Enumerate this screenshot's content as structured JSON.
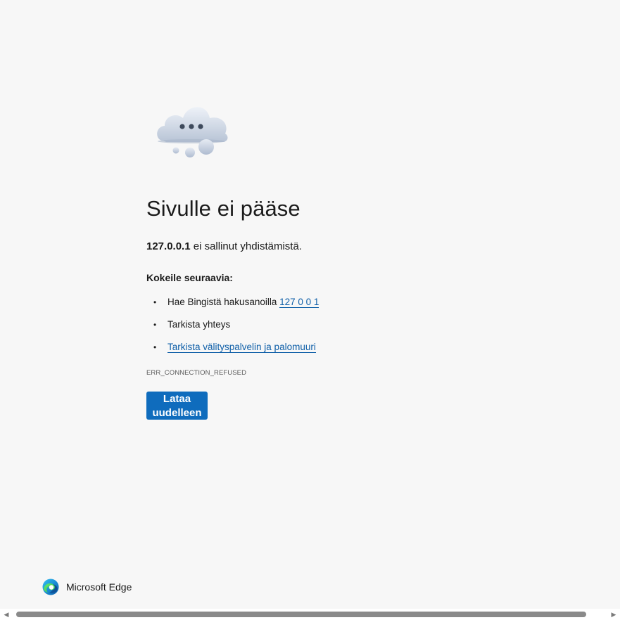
{
  "error_page": {
    "title": "Sivulle ei pääse",
    "message_host": "127.0.0.1",
    "message_text": " ei sallinut yhdistämistä.",
    "suggestions_heading": "Kokeile seuraavia:",
    "suggestions": [
      {
        "prefix": "Hae Bingistä hakusanoilla ",
        "link": "127 0 0 1"
      },
      {
        "prefix": "Tarkista yhteys",
        "link": ""
      },
      {
        "prefix": "",
        "link": "Tarkista välityspalvelin ja palomuuri"
      }
    ],
    "error_code": "ERR_CONNECTION_REFUSED",
    "reload_label": "Lataa uudelleen"
  },
  "brand": {
    "name": "Microsoft Edge",
    "icon": "edge-logo-icon"
  },
  "scrollbar": {
    "left_arrow": "◀",
    "right_arrow": "▶"
  },
  "colors": {
    "background": "#f7f7f7",
    "link": "#0f5fa8",
    "button": "#0f6cbd",
    "text": "#1b1b1b"
  }
}
